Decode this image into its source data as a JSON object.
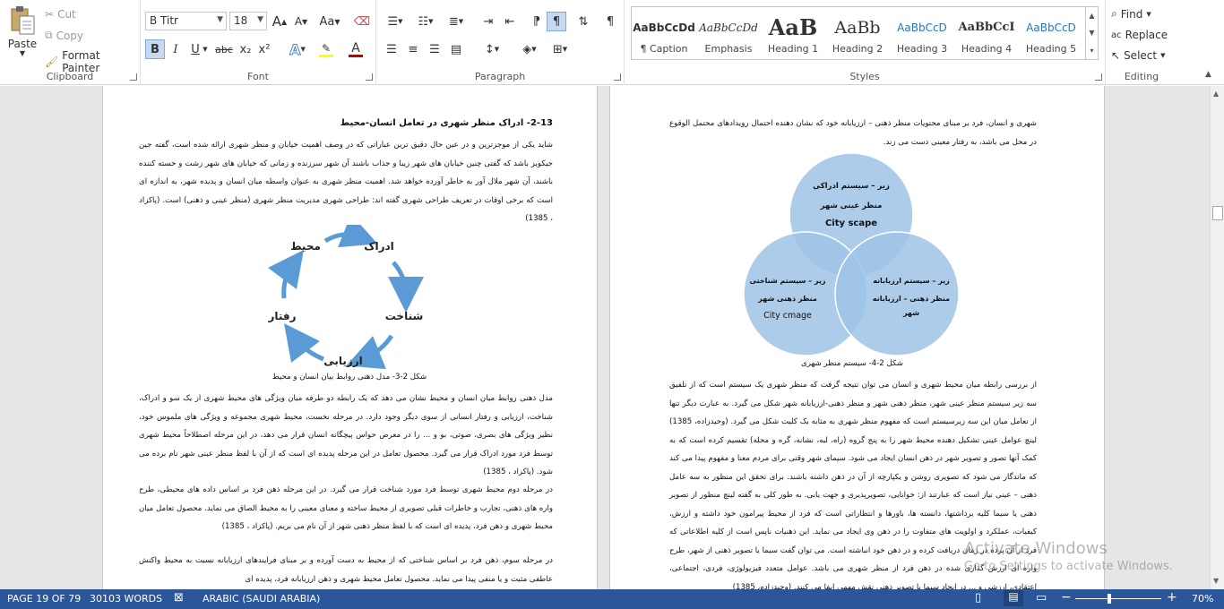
{
  "ribbon": {
    "clipboard": {
      "label": "Clipboard",
      "paste": "Paste",
      "cut": "Cut",
      "copy": "Copy",
      "format_painter": "Format Painter"
    },
    "font": {
      "label": "Font",
      "font_name": "B Titr",
      "font_size": "18",
      "grow": "A",
      "shrink": "A",
      "case": "Aa",
      "bold": "B",
      "italic": "I",
      "underline": "U",
      "strike": "abc",
      "subscript": "x₂",
      "superscript": "x²",
      "text_effects": "A",
      "font_color": "A",
      "highlight_color": "#ffff00",
      "font_color_value": "#c00000"
    },
    "paragraph": {
      "label": "Paragraph",
      "pilcrow": "¶"
    },
    "styles": {
      "label": "Styles",
      "items": [
        {
          "preview": "AaBbCcDd",
          "name": "¶ Caption"
        },
        {
          "preview": "AaBbCcDd",
          "name": "Emphasis"
        },
        {
          "preview": "AaB",
          "name": "Heading 1"
        },
        {
          "preview": "AaBb",
          "name": "Heading 2"
        },
        {
          "preview": "AaBbCcD",
          "name": "Heading 3"
        },
        {
          "preview": "AaBbCcI",
          "name": "Heading 4"
        },
        {
          "preview": "AaBbCcD",
          "name": "Heading 5"
        }
      ]
    },
    "editing": {
      "label": "Editing",
      "find": "Find",
      "replace": "Replace",
      "select": "Select"
    }
  },
  "left_page": {
    "heading": "2-13- ادراک منظر شهری در تعامل انسان-محیط",
    "para1": "شاید یکی از موجزترین و در عین حال دقیق ترین عباراتی که در وصف اهمیت خیابان و منظر شهری ارائه شده است، گفته جین جیکوبز باشد که گفتی چنین خیابان های شهر زیبا و جذاب باشند آن شهر سرزنده و زمانی که خیابان های شهر زشت و خسته کننده باشند، آن شهر ملال آور به خاطر آورده خواهد شد. اهمیت منظر شهری به عنوان واسطه میان انسان و پدیده شهر، به اندازه ای است که برخی اوقات در تعریف طراحی شهری گفته اند: طراحی شهری مدیریت منظر شهری (منظر عینی و ذهنی) است. (پاکزاد ، 1385)",
    "diagram_labels": {
      "perception": "ادراک",
      "environment": "محیط",
      "cognition": "شناخت",
      "behavior": "رفتار",
      "evaluation": "ارزیابی"
    },
    "caption": "شکل 2-3- مدل ذهنی روابط بیان انسان و محیط",
    "para2": "مدل ذهنی روابط میان انسان و محیط نشان می دهد که یک رابطه دو طرفه میان ویژگی های محیط شهری از یک سو و ادراک، شناخت، ارزیابی و رفتار انسانی از سوی دیگر وجود دارد. در مرحله نخست، محیط شهری مجموعه و ویژگی های ملموس خود، نظیر ویژگی های بصری، صوتی، بو و ... را در معرض حواس پیچگانه انسان قرار می دهد، در این مرحله اصطلاحاً محیط شهری توسط فرد مورد ادراک قرار می گیرد. محصول تعامل در این مرحله پدیده ای است که از آن با لفظ منظر عینی شهر نام برده می شود. (پاکزاد ، 1385)",
    "para3": "در مرحله دوم محیط شهری توسط فرد مورد شناخت قرار می گیرد. در این مرحله ذهن فرد بر اساس داده های محیطی، طرح واره های ذهنی، تجارب و خاطرات قبلی تصویری از محیط ساخته و معنای معینی را به محیط الصاق می نماید. محصول تعامل میان محیط شهری و ذهن فرد، پدیده ای است که با لفظ منظر ذهنی شهر از آن نام می بریم. (پاکزاد ، 1385)",
    "para4": "در مرحله سوم، ذهن فرد بر اساس شناختی که از محیط به دست آورده و بر مبنای فرایندهای ارزیابانه نسبت به محیط واکنش عاطفی مثبت و یا منفی پیدا می نماید. محصول تعامل محیط شهری و ذهن ارزیابانه فرد، پدیده ای"
  },
  "right_page": {
    "para_top": "شهری و انسان، فرد بر مبنای محتویات منظر ذهنی – ارزیابانه خود که نشان دهنده احتمال رویدادهای محتمل الوقوع در محل می باشد، به رفتار معینی دست می زند.",
    "venn": {
      "top_line1": "زیر – سیستم ادراکی",
      "top_line2": "منظر عینی شهر",
      "top_line3": "City scape",
      "left_line1": "زیر – سیستم شناختی",
      "left_line2": "منظر ذهنی شهر",
      "left_line3": "City cmage",
      "right_line1": "زیر – سیستم ارزیابانه",
      "right_line2": "منظر ذهنی – ارزیابانه",
      "right_line3": "شهر",
      "circle_color": "#9dc3e6"
    },
    "caption": "شکل 2-4- سیستم منظر شهری",
    "para_body": "از بررسی رابطه میان محیط شهری و انسان می توان نتیجه گرفت که منظر شهری یک سیستم است که از تلفیق سه زیر سیستم منظر عینی شهر، منظر ذهنی شهر و منظر ذهنی-ارزیابانه شهر شکل می گیرد. به عبارت دیگر تنها از تعامل میان این سه زیرسیستم است که مفهوم منظر شهری به مثابه یک کلیت شکل می گیرد. (وحیدزاده، 1385) لینچ عوامل عینی تشکیل دهنده محیط شهر را به پنج گروه (راه، لبه، نشانه، گره و محله) تقسیم کرده است که به کمک آنها تصور و تصویر شهر در ذهن انسان ایجاد می شود. سیمای شهر وقتی برای مردم معنا و مفهوم پیدا می کند که ماندگار می شود که تصویری روشن و یکپارچه از آن در ذهن داشته باشند. برای تحقق این منظور به سه عامل ذهنی – عینی نیاز است که عبارتند از: خوانایی، تصویرپذیری و جهت یابی. به طور کلی به گفته لینچ منظور از تصویر ذهنی یا سیما کلیه برداشتها، دانسته ها، باورها و انتظاراتی است که فرد از محیط پیرامون خود داشته و ارزش، کیفیات، عملکرد و اولویت های متفاوت را در ذهن وی ایجاد می نماید. این ذهنیات ناپس است از کلیه اطلاعاتی که فرد از آن پرده در زمان دریافت کرده و در ذهن خود انباشته است. می توان گفت سیما یا تصویر ذهنی از شهر، طرح واره ای ارزش گذاری شده در ذهن فرد از منظر شهری می باشد. عوامل متعدد فیزیولوژی، فردی، اجتماعی، اعتقادی، ارزشی و ... در ایجاد سیما یا تصویر ذهنی نقش مهمی ایفا می کنند. (وحیدزاده، 1385)"
  },
  "status": {
    "page": "PAGE 19 OF 79",
    "words": "30103 WORDS",
    "language": "ARABIC (SAUDI ARABIA)",
    "zoom": "70%"
  },
  "watermark": {
    "line1": "Activate Windows",
    "line2": "Go to Settings to activate Windows."
  }
}
